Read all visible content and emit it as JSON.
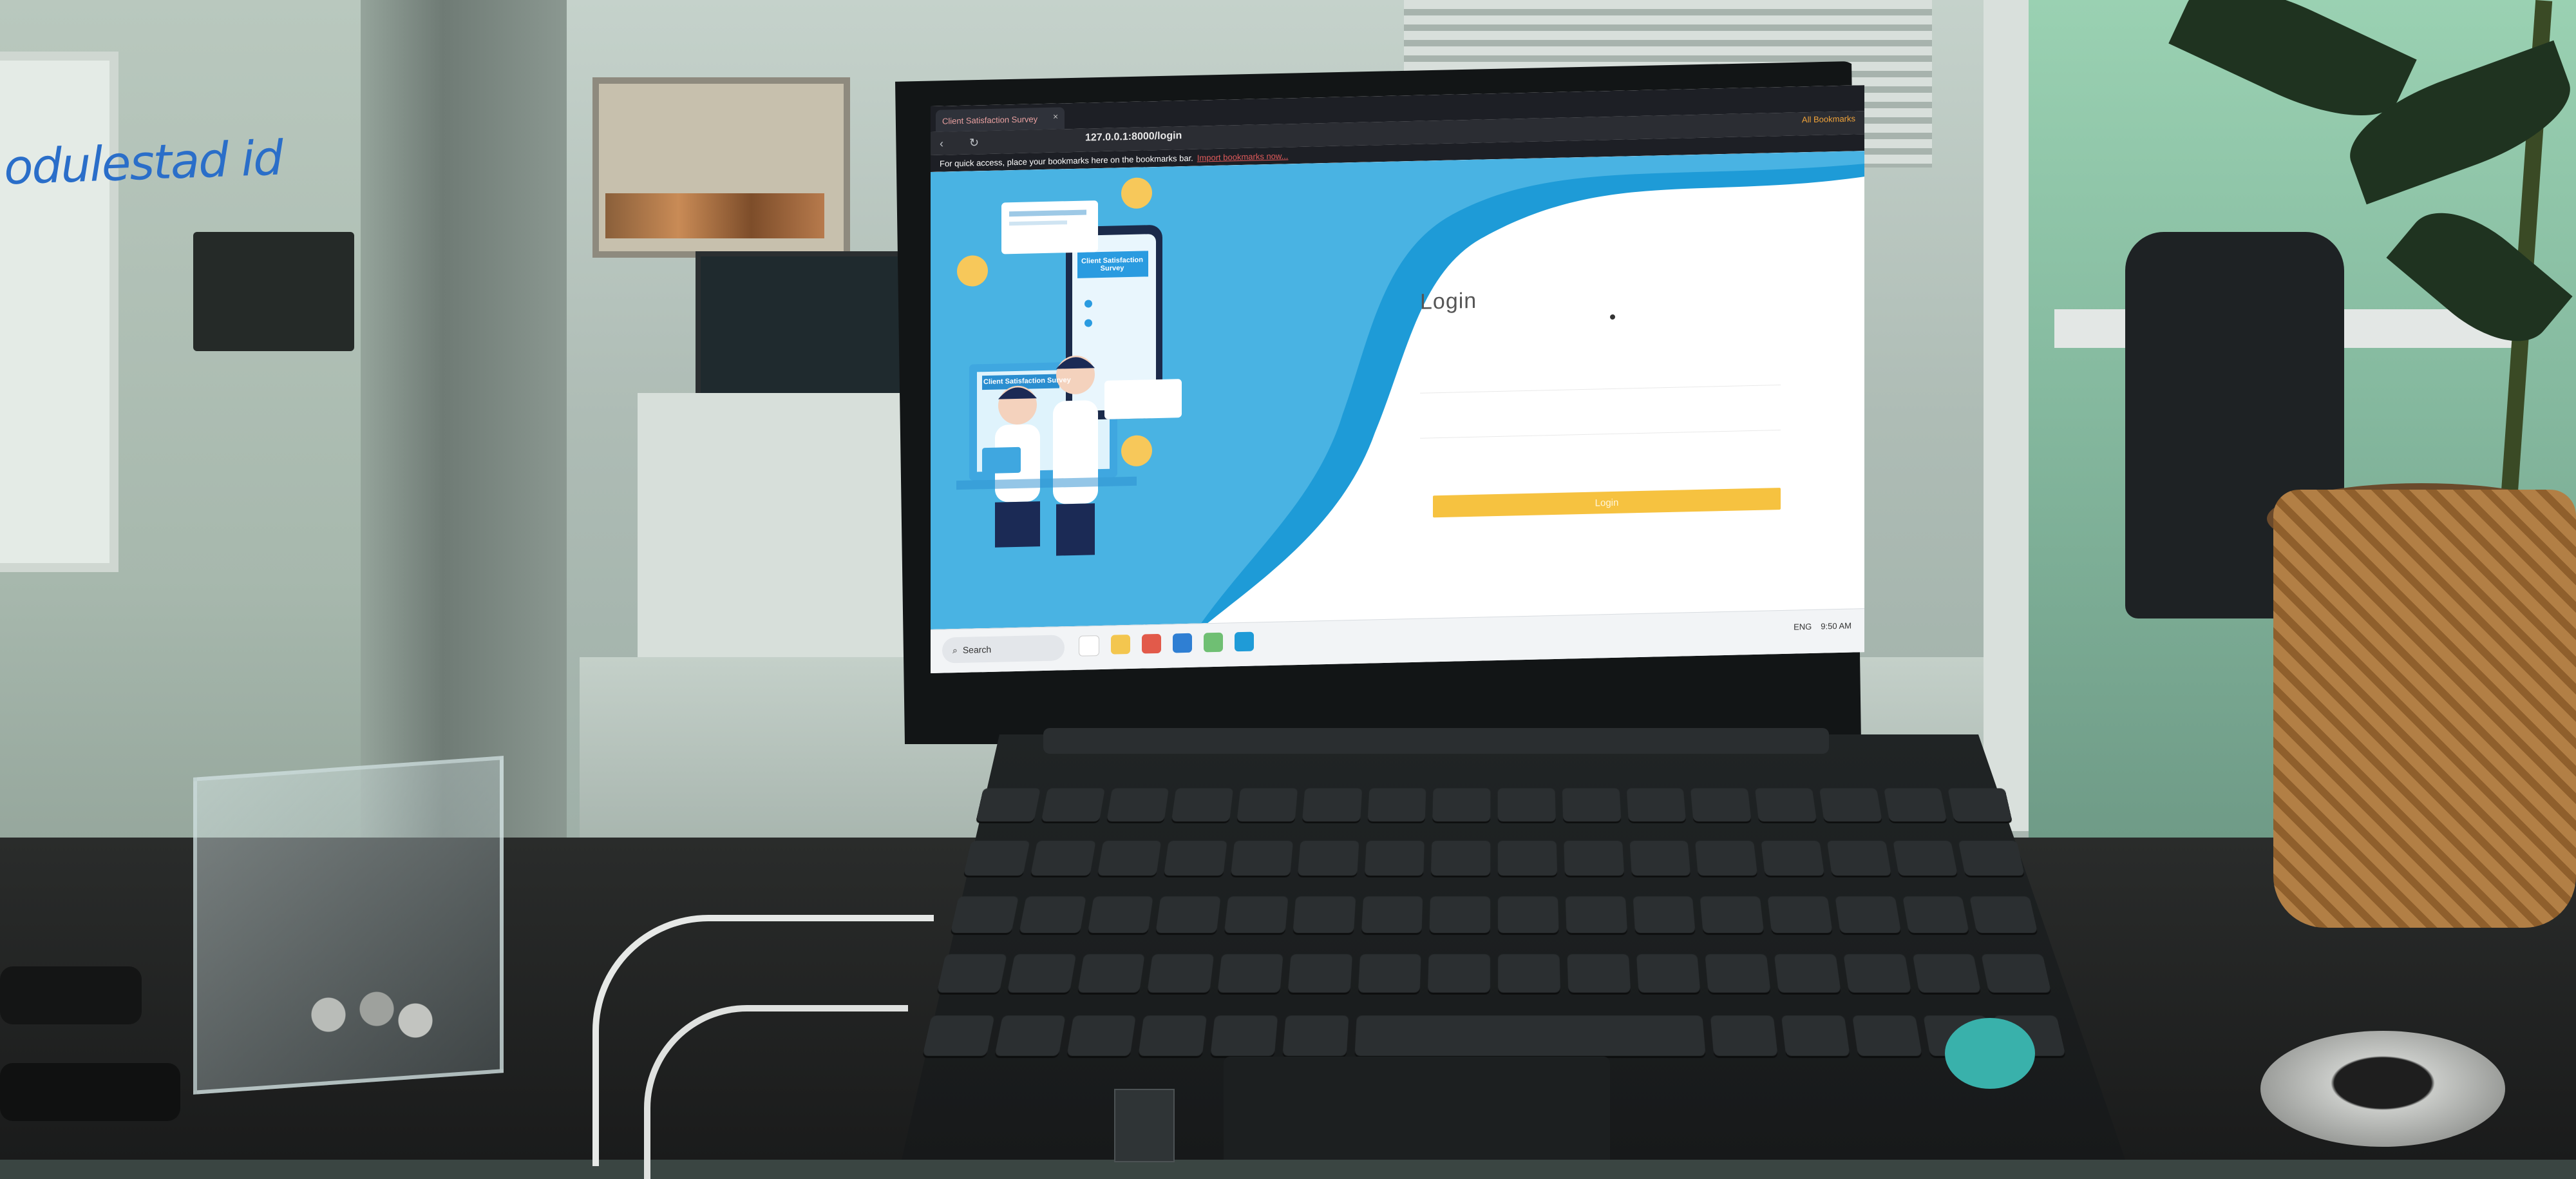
{
  "scene": {
    "whiteboard_text": "odulestad id"
  },
  "browser": {
    "tab_title": "Client Satisfaction Survey",
    "tab_close": "×",
    "url": "127.0.0.1:8000/login",
    "bookmarks_bar_text": "For quick access, place your bookmarks here on the bookmarks bar.",
    "bookmarks_bar_link": "Import bookmarks now...",
    "all_bookmarks": "All Bookmarks",
    "back_icon": "back-arrow-icon",
    "reload_icon": "reload-icon"
  },
  "illustration": {
    "monitor_banner": "Client Satisfaction Survey",
    "phone_banner": "Client Satisfaction Survey"
  },
  "login": {
    "title": "Login",
    "description": "",
    "username_label": "",
    "password_label": "",
    "forgot_label": "",
    "button_label": "Login"
  },
  "taskbar": {
    "search_label": "Search",
    "language": "ENG",
    "time": "9:50 AM"
  },
  "colors": {
    "wave_blue": "#1e9bd7",
    "login_button": "#f6c240",
    "browser_dark": "#1d1f25"
  }
}
